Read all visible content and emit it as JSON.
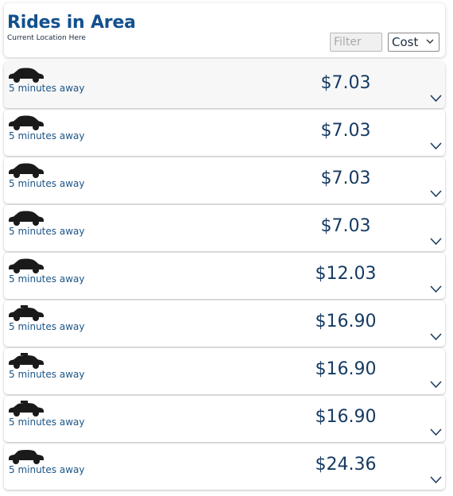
{
  "header": {
    "title": "Rides in Area",
    "subtitle": "Current Location Here",
    "filter_placeholder": "Filter",
    "sort_selected": "Cost"
  },
  "rides": [
    {
      "eta": "5 minutes away",
      "price": "$7.03",
      "vehicle_icon": "sedan-icon"
    },
    {
      "eta": "5 minutes away",
      "price": "$7.03",
      "vehicle_icon": "sedan-icon"
    },
    {
      "eta": "5 minutes away",
      "price": "$7.03",
      "vehicle_icon": "sedan-icon"
    },
    {
      "eta": "5 minutes away",
      "price": "$7.03",
      "vehicle_icon": "sedan-icon"
    },
    {
      "eta": "5 minutes away",
      "price": "$12.03",
      "vehicle_icon": "sedan-icon"
    },
    {
      "eta": "5 minutes away",
      "price": "$16.90",
      "vehicle_icon": "taxi-icon"
    },
    {
      "eta": "5 minutes away",
      "price": "$16.90",
      "vehicle_icon": "taxi-icon"
    },
    {
      "eta": "5 minutes away",
      "price": "$16.90",
      "vehicle_icon": "taxi-icon"
    },
    {
      "eta": "5 minutes away",
      "price": "$24.36",
      "vehicle_icon": "luxury-car-icon"
    }
  ],
  "colors": {
    "title": "#14508e",
    "eta": "#1b5486",
    "price": "#163a63",
    "icon": "#1a1a1a",
    "chevron": "#1c3d63"
  }
}
